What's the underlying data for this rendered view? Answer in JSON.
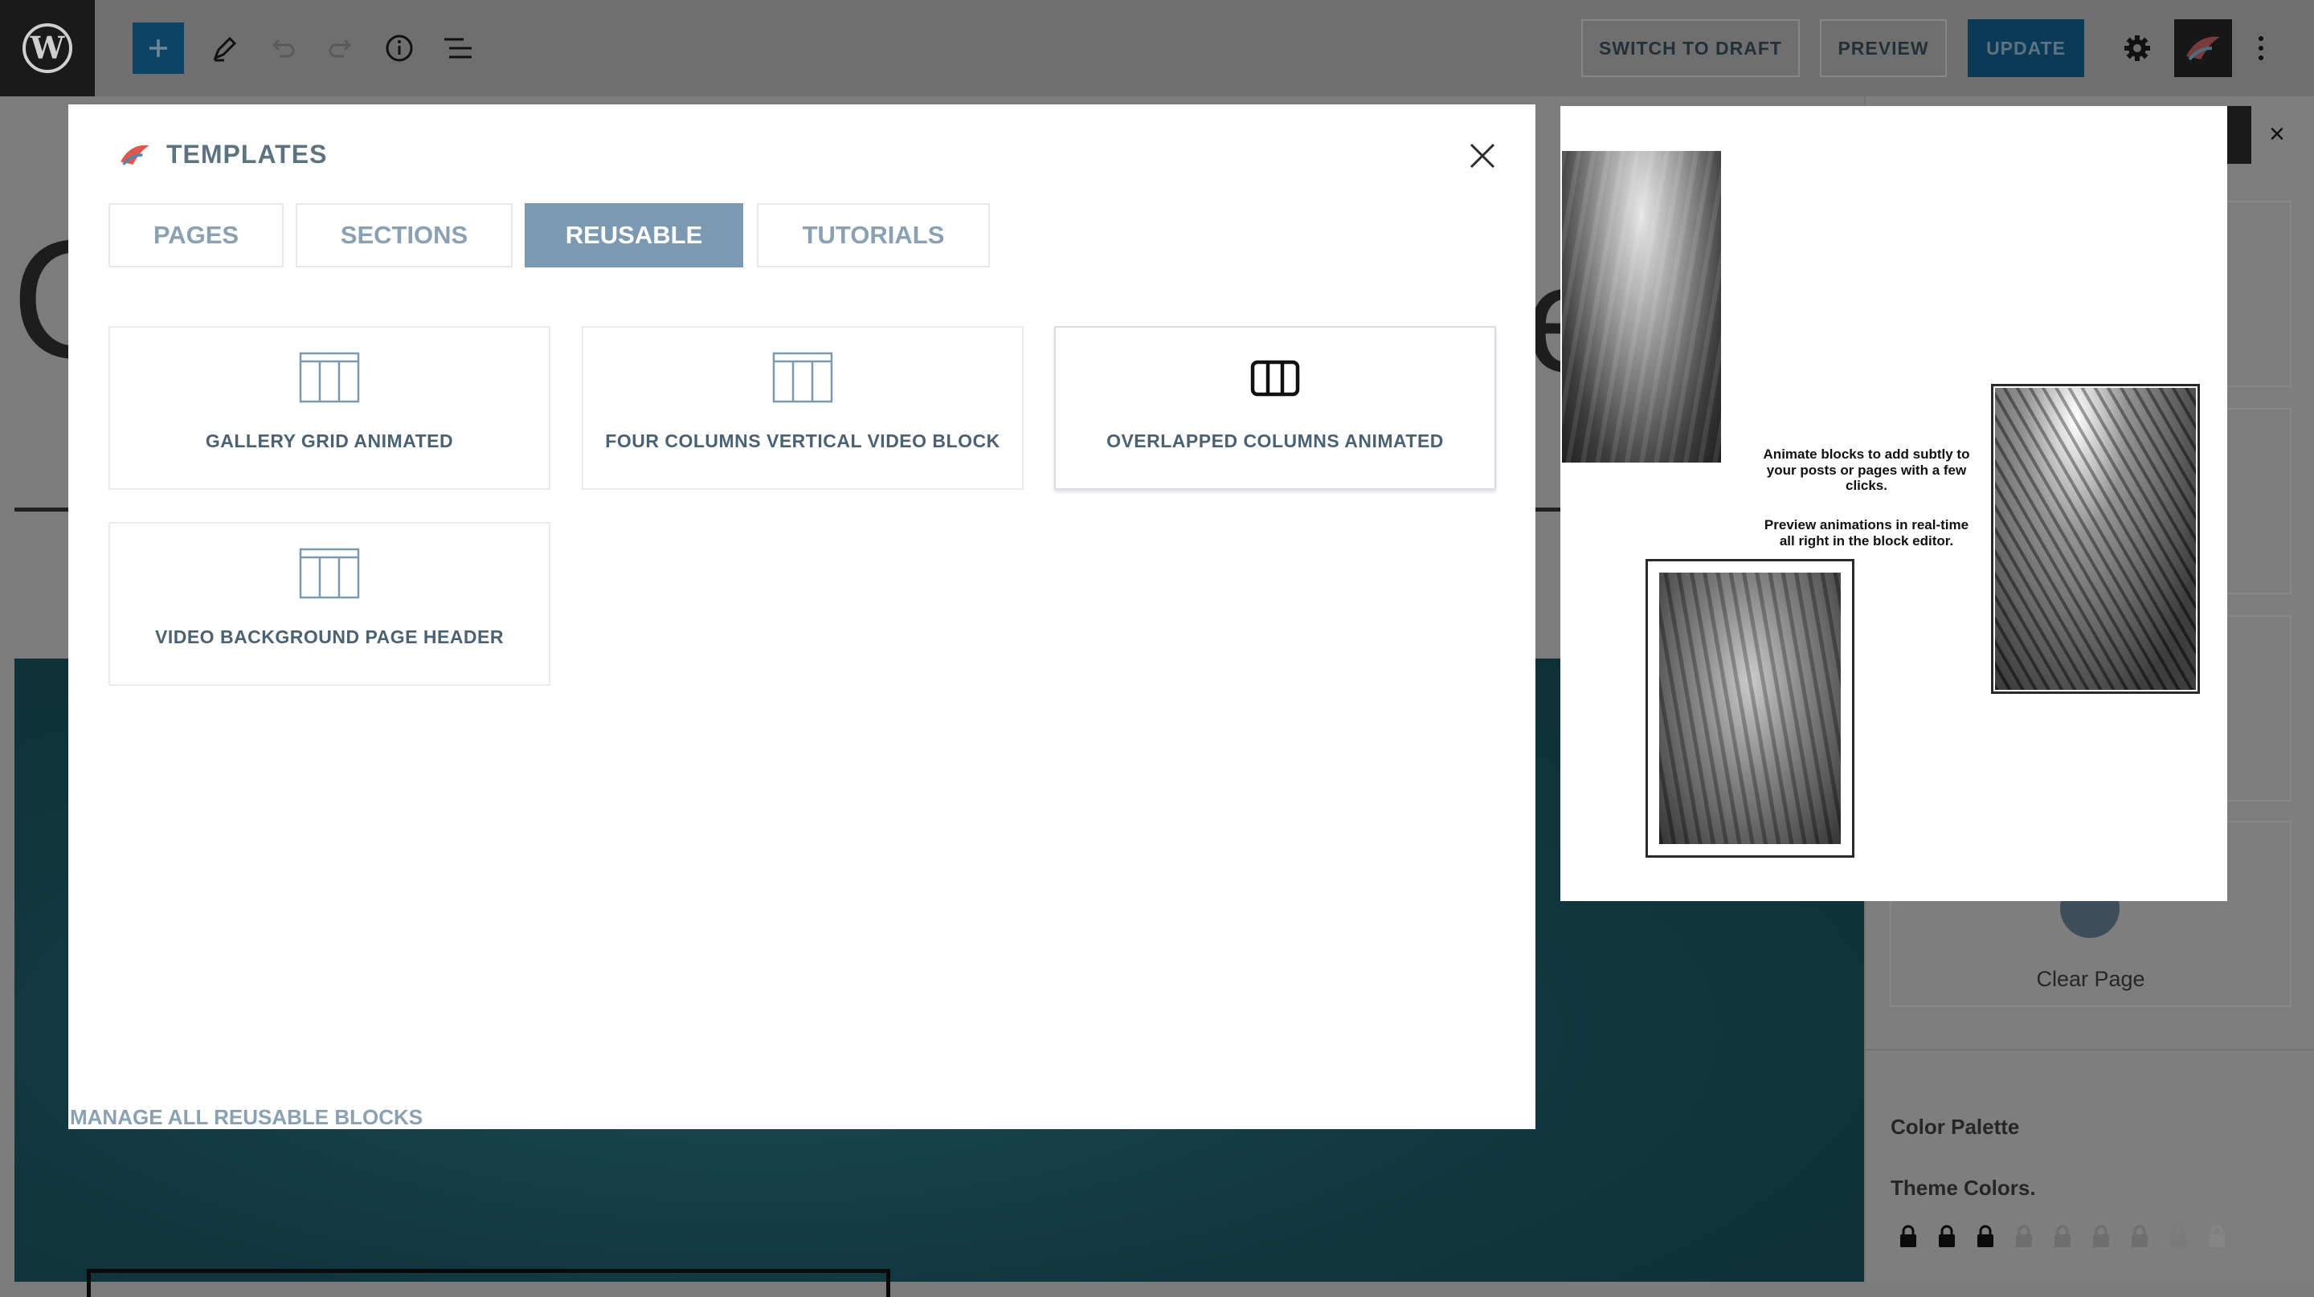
{
  "toolbar": {
    "switch_to_draft": "SWITCH TO DRAFT",
    "preview": "PREVIEW",
    "update": "UPDATE",
    "icons": [
      "wordpress-logo",
      "add-block",
      "tools-pencil",
      "undo",
      "redo",
      "details-info",
      "list-view",
      "settings-gear",
      "plugin-logo",
      "more-options"
    ]
  },
  "page_behind": {
    "letters": [
      "C",
      "e"
    ]
  },
  "sidebar_behind": {
    "clear_page": "Clear Page",
    "color_palette": "Color Palette",
    "theme_colors": "Theme Colors.",
    "close_symbol": "×"
  },
  "modal": {
    "title": "TEMPLATES",
    "tabs": [
      {
        "label": "PAGES",
        "active": false
      },
      {
        "label": "SECTIONS",
        "active": false
      },
      {
        "label": "REUSABLE",
        "active": true
      },
      {
        "label": "TUTORIALS",
        "active": false
      }
    ],
    "items": [
      {
        "label": "GALLERY GRID ANIMATED",
        "icon": "table-columns-icon"
      },
      {
        "label": "FOUR COLUMNS VERTICAL VIDEO BLOCK",
        "icon": "table-columns-icon"
      },
      {
        "label": "OVERLAPPED COLUMNS ANIMATED",
        "icon": "columns-icon"
      },
      {
        "label": "VIDEO BACKGROUND PAGE HEADER",
        "icon": "table-columns-icon"
      }
    ],
    "manage_link": "MANAGE ALL REUSABLE BLOCKS"
  },
  "preview": {
    "text_1": "Animate blocks to add subtly to your posts or pages with a few clicks.",
    "text_2": "Preview animations in real-time all right in the block editor."
  },
  "colors": {
    "accent_tab": "#7b9ab1",
    "label_text": "#4a6273",
    "update_button": "#0b3a57"
  }
}
